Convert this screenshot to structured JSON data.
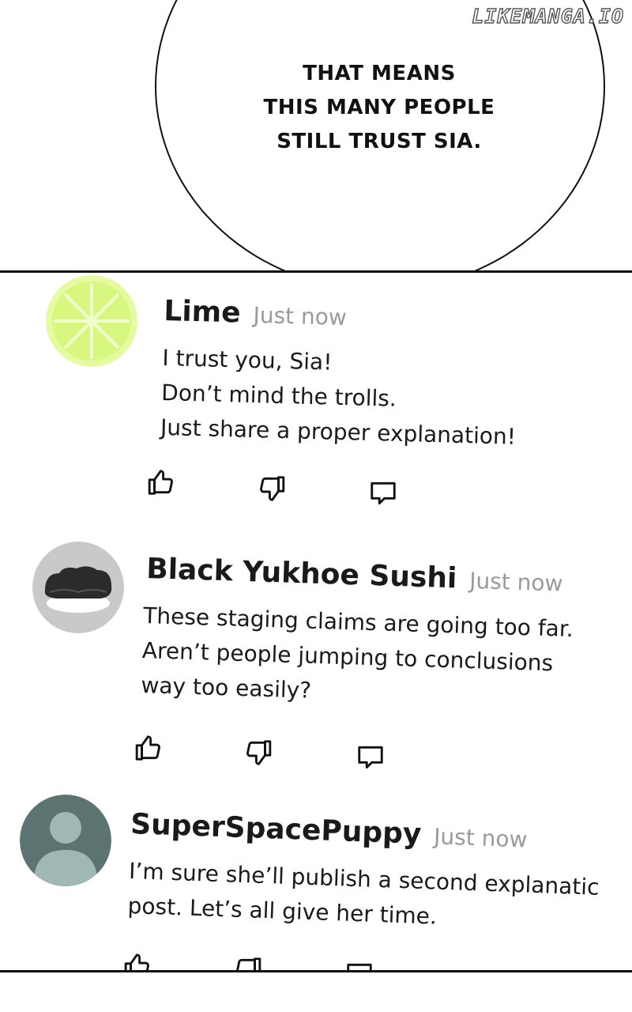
{
  "watermark": "LIKEMANGA.IO",
  "speech": {
    "lines": [
      "THAT MEANS",
      "THIS MANY PEOPLE",
      "STILL TRUST SIA."
    ]
  },
  "comments": [
    {
      "author": "Lime",
      "time": "Just now",
      "lines": [
        "I trust you, Sia!",
        "Don’t mind the trolls.",
        "Just share a proper explanation!"
      ],
      "avatar": "lime-slice"
    },
    {
      "author": "Black Yukhoe Sushi",
      "time": "Just now",
      "lines": [
        "These staging claims are going too far.",
        "Aren’t people jumping to conclusions",
        "way too easily?"
      ],
      "avatar": "sushi"
    },
    {
      "author": "SuperSpacePuppy",
      "time": "Just now",
      "lines": [
        "I’m sure she’ll publish a second explanatic",
        "post. Let’s all give her time."
      ],
      "avatar": "default-user"
    }
  ],
  "icons": [
    "thumbs-up-icon",
    "thumbs-down-icon",
    "reply-icon"
  ],
  "colors": {
    "lime": "#e6fba0",
    "default_avatar_bg": "#5b7472",
    "sushi_avatar_bg": "#c9c9c9",
    "timestamp": "#9a9a9a"
  }
}
